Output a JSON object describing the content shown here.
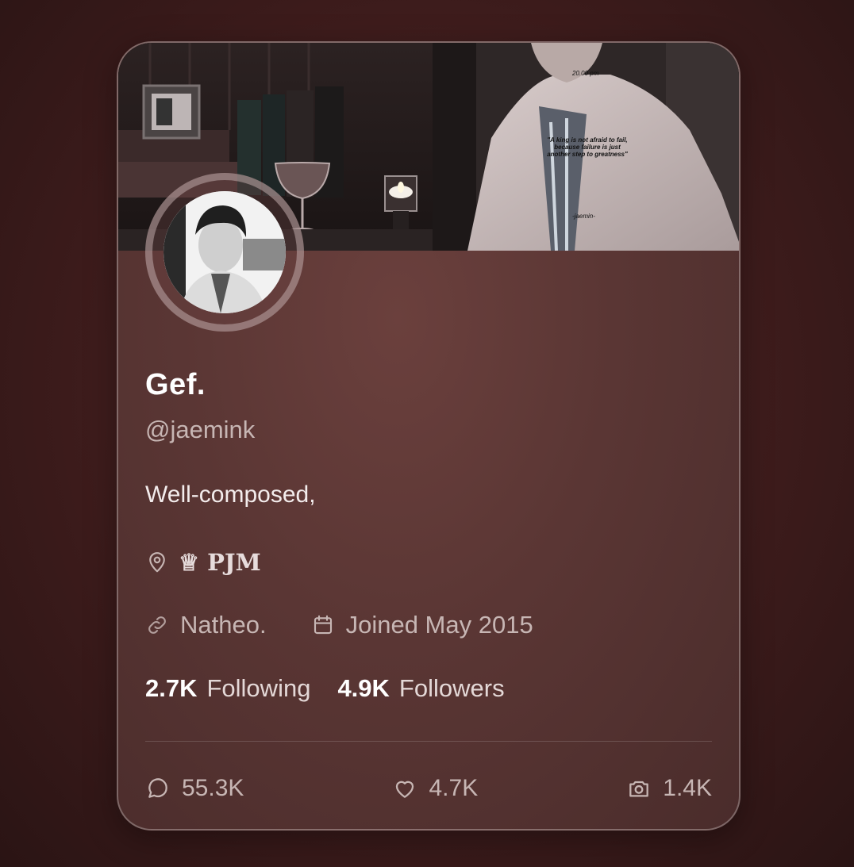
{
  "profile": {
    "name": "Gef.",
    "handle": "@jaemink",
    "bio": "Well-composed,",
    "location": "♕ PJM",
    "link": "Natheo.",
    "joined": "Joined May 2015"
  },
  "banner": {
    "time_text": "20.00 pm",
    "quote_text": "\"A king is not afraid to fail, because failure is just another step to greatness\"",
    "signature": "-jaemin-"
  },
  "stats": {
    "following_count": "2.7K",
    "following_label": "Following",
    "followers_count": "4.9K",
    "followers_label": "Followers"
  },
  "actions": {
    "replies": "55.3K",
    "likes": "4.7K",
    "media": "1.4K"
  },
  "icons": {
    "location": "map-pin-icon",
    "link": "link-icon",
    "calendar": "calendar-icon",
    "replies": "speech-bubble-icon",
    "likes": "heart-icon",
    "media": "camera-icon"
  },
  "colors": {
    "card_background": "#5a3634",
    "page_background": "#3e1c1c",
    "text_primary": "#ffffff",
    "text_muted": "#c7b6b4"
  }
}
